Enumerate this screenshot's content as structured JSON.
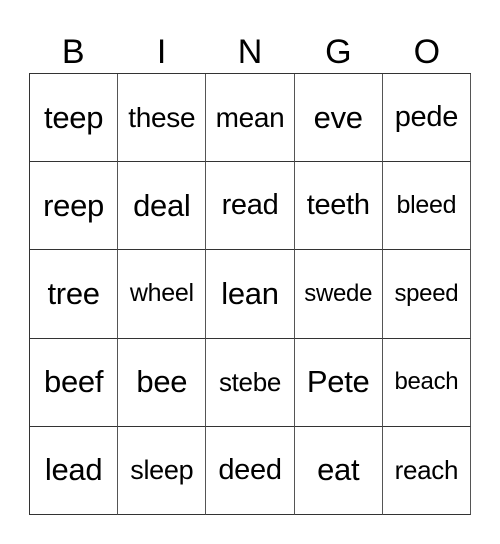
{
  "header": {
    "letters": [
      "B",
      "I",
      "N",
      "G",
      "O"
    ]
  },
  "grid": {
    "rows": [
      [
        "teep",
        "these",
        "mean",
        "eve",
        "pede"
      ],
      [
        "reep",
        "deal",
        "read",
        "teeth",
        "bleed"
      ],
      [
        "tree",
        "wheel",
        "lean",
        "swede",
        "speed"
      ],
      [
        "beef",
        "bee",
        "stebe",
        "Pete",
        "beach"
      ],
      [
        "lead",
        "sleep",
        "deed",
        "eat",
        "reach"
      ]
    ]
  }
}
